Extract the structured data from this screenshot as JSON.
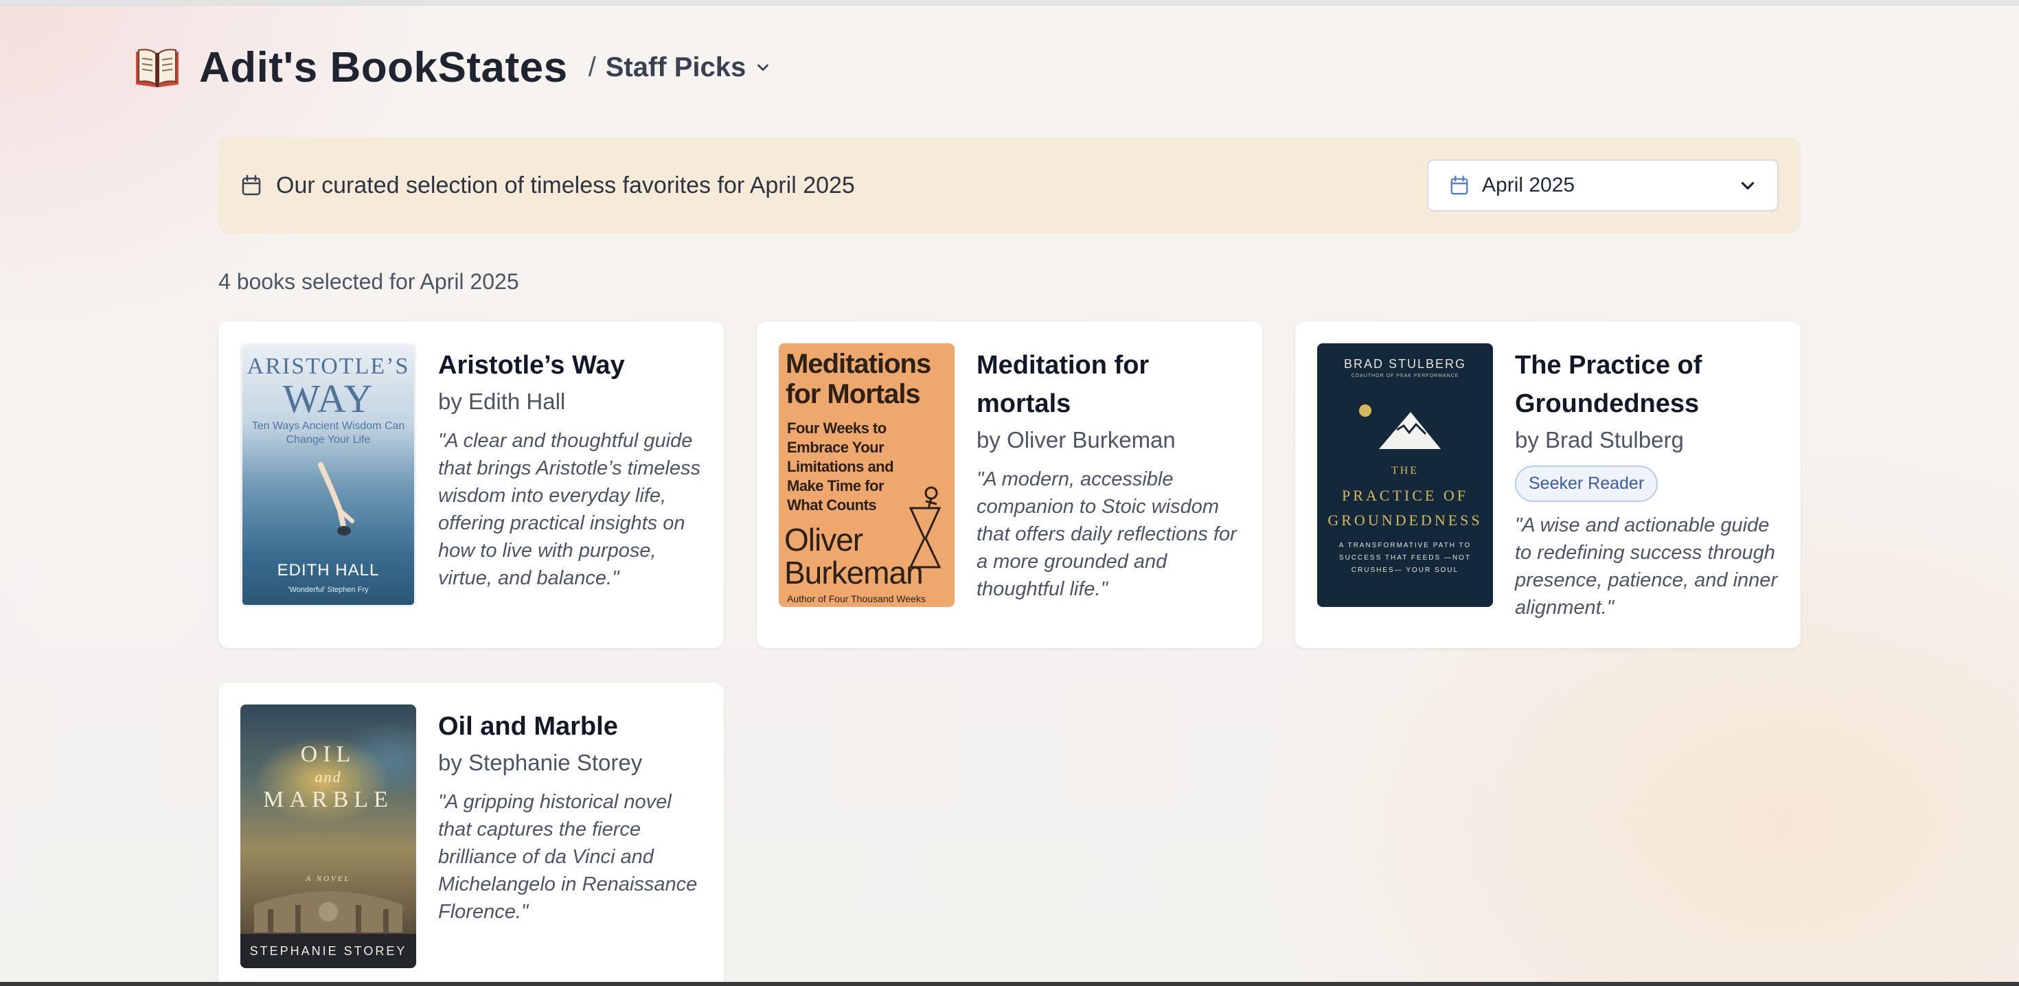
{
  "header": {
    "app_title": "Adit's BookStates",
    "separator": "/",
    "crumb": "Staff Picks"
  },
  "banner": {
    "text": "Our curated selection of timeless favorites for April 2025",
    "month_select": "April 2025"
  },
  "count_text": "4 books selected for April 2025",
  "books": [
    {
      "title": "Aristotle’s Way",
      "author": "by Edith Hall",
      "quote": "\"A clear and thoughtful guide that brings Aristotle’s timeless wisdom into everyday life, offering practical insights on how to live with purpose, virtue, and balance.\"",
      "cover": {
        "line1": "ARISTOTLE’S",
        "line2": "WAY",
        "subtitle": "Ten Ways Ancient Wisdom Can Change Your Life",
        "author": "EDITH HALL",
        "blurb": "'Wonderful' Stephen Fry"
      }
    },
    {
      "title": "Meditation for mortals",
      "author": "by Oliver Burkeman",
      "quote": "\"A modern, accessible companion to Stoic wisdom that offers daily reflections for a more grounded and thoughtful life.\"",
      "cover": {
        "title": "Meditations for Mortals",
        "subtitle": "Four Weeks to Embrace Your Limitations and Make Time for What Counts",
        "author": "Oliver Burkeman",
        "note": "Author of Four Thousand Weeks"
      }
    },
    {
      "title": "The Practice of Groundedness",
      "author": "by Brad Stulberg",
      "badge": "Seeker Reader",
      "quote": "\"A wise and actionable guide to redefining success through presence, patience, and inner alignment.\"",
      "cover": {
        "author": "BRAD STULBERG",
        "author_note": "COAUTHOR OF PEAK PERFORMANCE",
        "line1": "THE",
        "line2": "PRACTICE OF",
        "line3": "GROUNDEDNESS",
        "tagline": "A TRANSFORMATIVE PATH TO SUCCESS THAT FEEDS —NOT CRUSHES— YOUR SOUL"
      }
    },
    {
      "title": "Oil and Marble",
      "author": "by Stephanie Storey",
      "quote": "\"A gripping historical novel that captures the fierce brilliance of da Vinci and Michelangelo in Renaissance Florence.\"",
      "cover": {
        "line1": "OIL",
        "line2": "and",
        "line3": "MARBLE",
        "genre": "A NOVEL",
        "author": "STEPHANIE STOREY"
      }
    }
  ],
  "colors": {
    "banner_bg": "#f6ead9",
    "badge_text": "#3b5ba5",
    "badge_bg": "#eef3fc"
  },
  "icons": {
    "logo": "open-book-icon",
    "banner": "calendar-icon",
    "select": "calendar-icon",
    "dropdown": "chevron-down-icon"
  }
}
